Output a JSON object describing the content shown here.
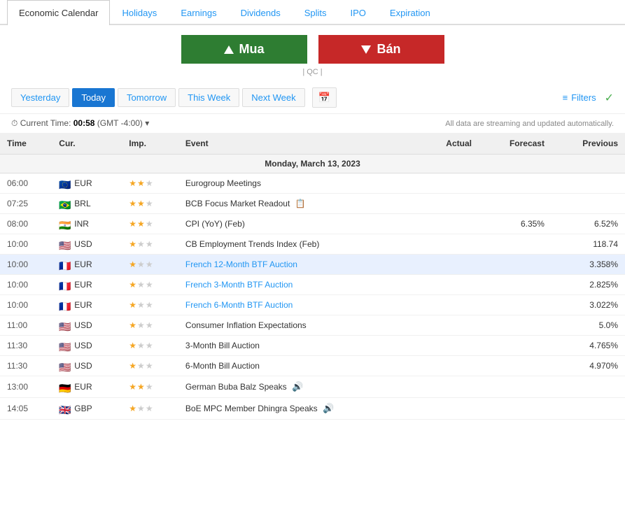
{
  "tabs": [
    {
      "label": "Economic Calendar",
      "active": true
    },
    {
      "label": "Holidays",
      "active": false
    },
    {
      "label": "Earnings",
      "active": false
    },
    {
      "label": "Dividends",
      "active": false
    },
    {
      "label": "Splits",
      "active": false
    },
    {
      "label": "IPO",
      "active": false
    },
    {
      "label": "Expiration",
      "active": false
    }
  ],
  "banner": {
    "mua_label": "Mua",
    "ban_label": "Bán",
    "qc_label": "| QC |"
  },
  "date_nav": {
    "buttons": [
      "Yesterday",
      "Today",
      "Tomorrow",
      "This Week",
      "Next Week"
    ],
    "active_index": 1,
    "filters_label": "Filters"
  },
  "current_time": {
    "label": "Current Time:",
    "value": "00:58",
    "gmt": "(GMT -4:00)",
    "streaming_note": "All data are streaming and updated automatically."
  },
  "table_headers": {
    "time": "Time",
    "cur": "Cur.",
    "imp": "Imp.",
    "event": "Event",
    "actual": "Actual",
    "forecast": "Forecast",
    "previous": "Previous"
  },
  "date_section": "Monday, March 13, 2023",
  "rows": [
    {
      "time": "06:00",
      "flag": "🇪🇺",
      "currency": "EUR",
      "imp_stars": 2,
      "event": "Eurogroup Meetings",
      "event_link": false,
      "has_speaker": false,
      "has_notepad": false,
      "actual": "",
      "forecast": "",
      "previous": "",
      "highlighted": false
    },
    {
      "time": "07:25",
      "flag": "🇧🇷",
      "currency": "BRL",
      "imp_stars": 2,
      "event": "BCB Focus Market Readout",
      "event_link": false,
      "has_speaker": false,
      "has_notepad": true,
      "actual": "",
      "forecast": "",
      "previous": "",
      "highlighted": false
    },
    {
      "time": "08:00",
      "flag": "🇮🇳",
      "currency": "INR",
      "imp_stars": 2,
      "event": "CPI (YoY) (Feb)",
      "event_link": false,
      "has_speaker": false,
      "has_notepad": false,
      "actual": "",
      "forecast": "6.35%",
      "previous": "6.52%",
      "highlighted": false
    },
    {
      "time": "10:00",
      "flag": "🇺🇸",
      "currency": "USD",
      "imp_stars": 1,
      "event": "CB Employment Trends Index (Feb)",
      "event_link": false,
      "has_speaker": false,
      "has_notepad": false,
      "actual": "",
      "forecast": "",
      "previous": "118.74",
      "highlighted": false
    },
    {
      "time": "10:00",
      "flag": "🇫🇷",
      "currency": "EUR",
      "imp_stars": 1,
      "event": "French 12-Month BTF Auction",
      "event_link": true,
      "has_speaker": false,
      "has_notepad": false,
      "actual": "",
      "forecast": "",
      "previous": "3.358%",
      "highlighted": true
    },
    {
      "time": "10:00",
      "flag": "🇫🇷",
      "currency": "EUR",
      "imp_stars": 1,
      "event": "French 3-Month BTF Auction",
      "event_link": true,
      "has_speaker": false,
      "has_notepad": false,
      "actual": "",
      "forecast": "",
      "previous": "2.825%",
      "highlighted": false
    },
    {
      "time": "10:00",
      "flag": "🇫🇷",
      "currency": "EUR",
      "imp_stars": 1,
      "event": "French 6-Month BTF Auction",
      "event_link": true,
      "has_speaker": false,
      "has_notepad": false,
      "actual": "",
      "forecast": "",
      "previous": "3.022%",
      "highlighted": false
    },
    {
      "time": "11:00",
      "flag": "🇺🇸",
      "currency": "USD",
      "imp_stars": 1,
      "event": "Consumer Inflation Expectations",
      "event_link": false,
      "has_speaker": false,
      "has_notepad": false,
      "actual": "",
      "forecast": "",
      "previous": "5.0%",
      "highlighted": false
    },
    {
      "time": "11:30",
      "flag": "🇺🇸",
      "currency": "USD",
      "imp_stars": 1,
      "event": "3-Month Bill Auction",
      "event_link": false,
      "has_speaker": false,
      "has_notepad": false,
      "actual": "",
      "forecast": "",
      "previous": "4.765%",
      "highlighted": false
    },
    {
      "time": "11:30",
      "flag": "🇺🇸",
      "currency": "USD",
      "imp_stars": 1,
      "event": "6-Month Bill Auction",
      "event_link": false,
      "has_speaker": false,
      "has_notepad": false,
      "actual": "",
      "forecast": "",
      "previous": "4.970%",
      "highlighted": false
    },
    {
      "time": "13:00",
      "flag": "🇩🇪",
      "currency": "EUR",
      "imp_stars": 2,
      "event": "German Buba Balz Speaks",
      "event_link": false,
      "has_speaker": true,
      "has_notepad": false,
      "actual": "",
      "forecast": "",
      "previous": "",
      "highlighted": false
    },
    {
      "time": "14:05",
      "flag": "🇬🇧",
      "currency": "GBP",
      "imp_stars": 1,
      "event": "BoE MPC Member Dhingra Speaks",
      "event_link": false,
      "has_speaker": true,
      "has_notepad": false,
      "actual": "",
      "forecast": "",
      "previous": "",
      "highlighted": false
    }
  ]
}
